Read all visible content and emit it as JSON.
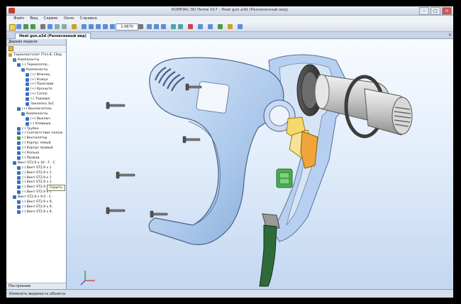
{
  "window": {
    "title": "КОМПАС-3D Home V17 - Heat gun.a3d (Разнесенный вид)"
  },
  "menu": [
    "Файл",
    "Вид",
    "Сервис",
    "Окно",
    "Справка"
  ],
  "toolbar": {
    "zoom_value": "1.0670"
  },
  "document_tab": {
    "label": "Heat gun.a3d (Разнесенный вид)"
  },
  "left_panel": {
    "title": "Дерево модели",
    "tree": [
      {
        "label": "Термопистолет (Тел-8, Сбор",
        "level": 0,
        "icon": "assembly-icon",
        "color": "#c9a227"
      },
      {
        "label": "Компоненты",
        "level": 1,
        "icon": "folder-icon",
        "color": "#4b7bc4"
      },
      {
        "label": "(-) Термосопло...",
        "level": 2,
        "icon": "part-icon",
        "color": "#3a6fbf"
      },
      {
        "label": "Компоненты",
        "level": 3,
        "icon": "folder-icon",
        "color": "#4b7bc4"
      },
      {
        "label": "(+) Фланец",
        "level": 4,
        "icon": "part-icon",
        "color": "#3a6fbf"
      },
      {
        "label": "(+) Кожух",
        "level": 4,
        "icon": "part-icon",
        "color": "#3a6fbf"
      },
      {
        "label": "(+) Прокладк",
        "level": 4,
        "icon": "part-icon",
        "color": "#3a6fbf"
      },
      {
        "label": "(+) Кронште",
        "level": 4,
        "icon": "part-icon",
        "color": "#3a6fbf"
      },
      {
        "label": "(+) Сопло",
        "level": 4,
        "icon": "part-icon",
        "color": "#3a6fbf"
      },
      {
        "label": "(-) Терморе",
        "level": 4,
        "icon": "part-icon",
        "color": "#3a6fbf"
      },
      {
        "label": "Заклепка 3х1",
        "level": 4,
        "icon": "part-icon",
        "color": "#3a6fbf"
      },
      {
        "label": "(+) Выключатель",
        "level": 2,
        "icon": "part-icon",
        "color": "#3a6fbf"
      },
      {
        "label": "Компоненты",
        "level": 3,
        "icon": "folder-icon",
        "color": "#4b7bc4"
      },
      {
        "label": "(+) Выключ",
        "level": 4,
        "icon": "part-icon",
        "color": "#3a6fbf"
      },
      {
        "label": "(-) Клавиша",
        "level": 4,
        "icon": "part-icon",
        "color": "#3a6fbf"
      },
      {
        "label": "(-) Трубка",
        "level": 2,
        "icon": "part-icon",
        "color": "#3a6fbf"
      },
      {
        "label": "(-) Соответствие полож",
        "level": 2,
        "icon": "part-icon",
        "color": "#3a6fbf"
      },
      {
        "label": "(-) Вентилятор",
        "level": 2,
        "icon": "part-icon",
        "color": "#3a9a3a"
      },
      {
        "label": "(-) Корпус левый",
        "level": 2,
        "icon": "part-icon",
        "color": "#3a6fbf"
      },
      {
        "label": "(-) Корпус правый",
        "level": 2,
        "icon": "part-icon",
        "color": "#3a6fbf"
      },
      {
        "label": "(-) Кольцо",
        "level": 2,
        "icon": "part-icon",
        "color": "#3a6fbf"
      },
      {
        "label": "(-) Провод",
        "level": 2,
        "icon": "part-icon",
        "color": "#3a6fbf"
      },
      {
        "label": "Винт ST2,9 х 16 - F - C",
        "level": 1,
        "icon": "screw-icon",
        "color": "#3a6fbf"
      },
      {
        "label": "(-) Винт ST2,9 х 1",
        "level": 2,
        "icon": "screw-icon",
        "color": "#3a6fbf"
      },
      {
        "label": "(-) Винт ST2,9 х 1",
        "level": 2,
        "icon": "screw-icon",
        "color": "#3a6fbf"
      },
      {
        "label": "(-) Винт ST2,9 х 1",
        "level": 2,
        "icon": "screw-icon",
        "color": "#3a6fbf"
      },
      {
        "label": "(-) Винт ST2,9 х 1",
        "level": 2,
        "icon": "screw-icon",
        "color": "#3a6fbf"
      },
      {
        "label": "(-) Винт ST2,9 х 1",
        "level": 2,
        "icon": "screw-icon",
        "color": "#3a6fbf"
      },
      {
        "label": "(-) Винт ST2,9 х 1",
        "level": 2,
        "icon": "screw-icon",
        "color": "#3a6fbf"
      },
      {
        "label": "Винт ST2,9 х 9,5 - C - ",
        "level": 1,
        "icon": "screw-icon",
        "color": "#3a6fbf"
      },
      {
        "label": "(-) Винт ST2,9 х 9,",
        "level": 2,
        "icon": "screw-icon",
        "color": "#3a6fbf"
      },
      {
        "label": "(-) Винт ST2,9 х 9,",
        "level": 2,
        "icon": "screw-icon",
        "color": "#3a6fbf"
      },
      {
        "label": "(-) Винт ST2,9 х 9,",
        "level": 2,
        "icon": "screw-icon",
        "color": "#3a6fbf"
      }
    ],
    "tooltip": "Скрыть",
    "bottom_label": "Построение"
  },
  "status": {
    "text": "Изменить видимость объекта"
  },
  "colors": {
    "body": "#a9c6ea",
    "fan": "#4caf50",
    "switch": "#f0a43a",
    "cable": "#2f6b3a"
  }
}
